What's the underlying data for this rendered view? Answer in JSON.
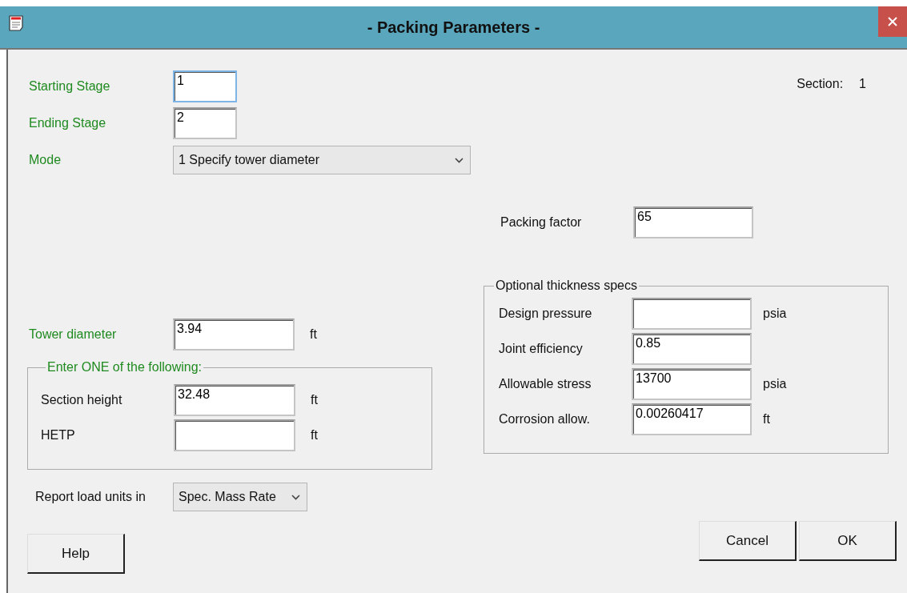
{
  "window": {
    "title": "- Packing Parameters -"
  },
  "section": {
    "label": "Section:",
    "value": "1"
  },
  "stages": [
    {
      "label": "Starting Stage",
      "value": "1",
      "focused": true
    },
    {
      "label": "Ending Stage",
      "value": "2",
      "focused": false
    }
  ],
  "mode": {
    "label": "Mode",
    "value": "1 Specify tower diameter"
  },
  "packing_factor": {
    "label": "Packing factor",
    "value": "65"
  },
  "tower_diameter": {
    "label": "Tower diameter",
    "value": "3.94",
    "unit": "ft"
  },
  "height_group": {
    "legend": "Enter ONE of the following:",
    "fields": [
      {
        "label": "Section height",
        "value": "32.48",
        "unit": "ft"
      },
      {
        "label": "HETP",
        "unit": "ft"
      }
    ]
  },
  "thickness_group": {
    "legend": "Optional thickness specs",
    "fields": [
      {
        "label": "Design pressure",
        "unit": "psia"
      },
      {
        "label": "Joint efficiency",
        "value": "0.85"
      },
      {
        "label": "Allowable stress",
        "value": "13700",
        "unit": "psia"
      },
      {
        "label": "Corrosion allow.",
        "value": "0.00260417",
        "unit": "ft"
      }
    ]
  },
  "report_units": {
    "label": "Report load units in",
    "value": "Spec. Mass Rate"
  },
  "buttons": {
    "help": "Help",
    "cancel": "Cancel",
    "ok": "OK"
  }
}
